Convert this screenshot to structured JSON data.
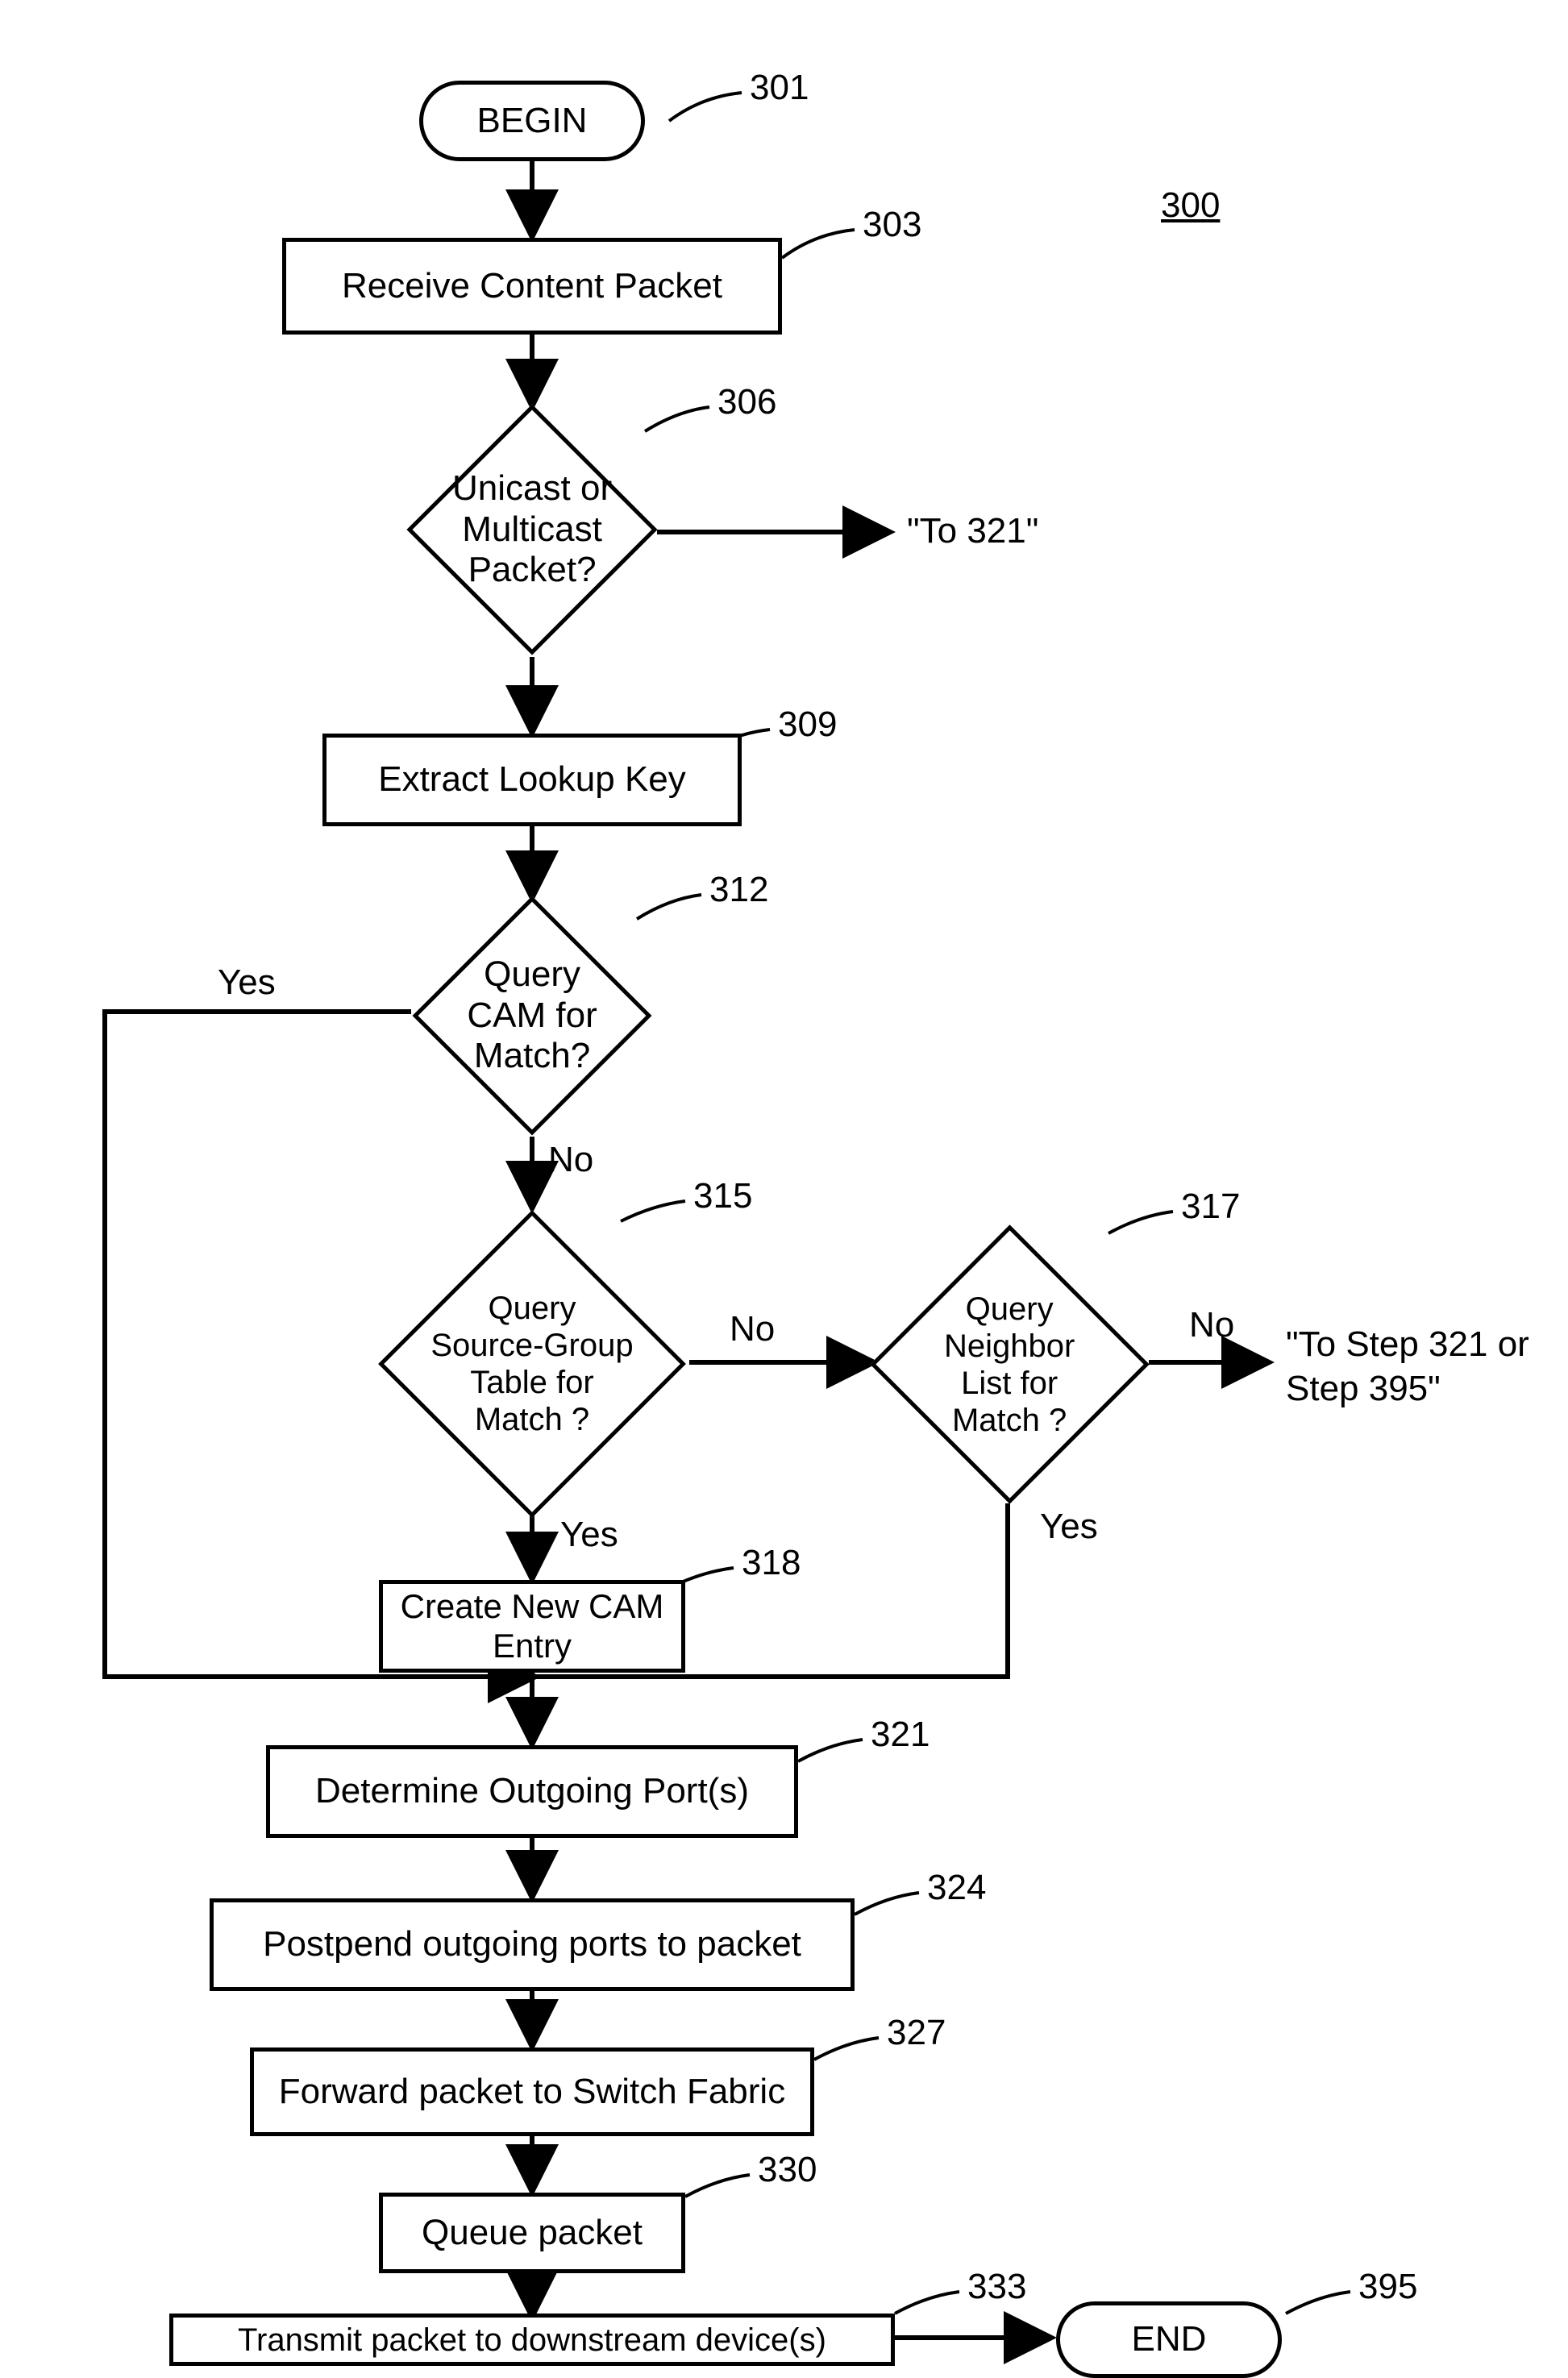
{
  "fig_ref": "300",
  "refs": {
    "n301": "301",
    "n303": "303",
    "n306": "306",
    "n309": "309",
    "n312": "312",
    "n315": "315",
    "n317": "317",
    "n318": "318",
    "n321": "321",
    "n324": "324",
    "n327": "327",
    "n330": "330",
    "n333": "333",
    "n395": "395"
  },
  "text": {
    "begin": "BEGIN",
    "end": "END",
    "n303": "Receive Content Packet",
    "n306": "Unicast or Multicast Packet?",
    "n309": "Extract Lookup Key",
    "n312": "Query CAM for Match?",
    "n315": "Query Source-Group Table for Match ?",
    "n317": "Query Neighbor List for Match ?",
    "n318": "Create New CAM Entry",
    "n321": "Determine Outgoing Port(s)",
    "n324": "Postpend outgoing ports to packet",
    "n327": "Forward packet to Switch Fabric",
    "n330": "Queue packet",
    "n333": "Transmit packet to downstream device(s)"
  },
  "edge": {
    "yes": "Yes",
    "no": "No",
    "to321": "\"To 321\"",
    "to321_or_395": "\"To Step 321 or Step 395\""
  }
}
